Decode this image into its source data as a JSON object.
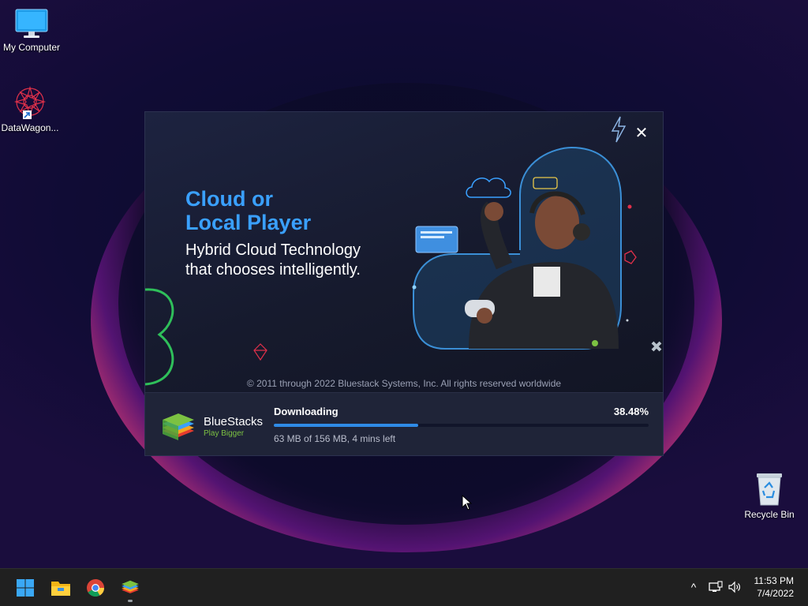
{
  "desktop": {
    "icons": [
      {
        "label": "My Computer"
      },
      {
        "label": "DataWagon..."
      },
      {
        "label": "Recycle Bin"
      }
    ]
  },
  "installer": {
    "headline_line1": "Cloud or",
    "headline_line2": "Local Player",
    "subline_line1": "Hybrid Cloud Technology",
    "subline_line2": "that chooses intelligently.",
    "copyright": "© 2011 through 2022 Bluestack Systems, Inc. All rights reserved worldwide",
    "close_glyph": "✕",
    "brand_name": "BlueStacks",
    "brand_tagline": "Play Bigger",
    "status": "Downloading",
    "percent_label": "38.48%",
    "progress": 0.3848,
    "detail": "63 MB of 156 MB, 4 mins left",
    "accent_color": "#3aa0ff",
    "progress_color": "#2f8be6"
  },
  "taskbar": {
    "apps": [
      "start-icon",
      "file-explorer-icon",
      "chrome-icon",
      "bluestacks-icon"
    ],
    "tray_chevron": "^",
    "time": "11:53 PM",
    "date": "7/4/2022"
  }
}
